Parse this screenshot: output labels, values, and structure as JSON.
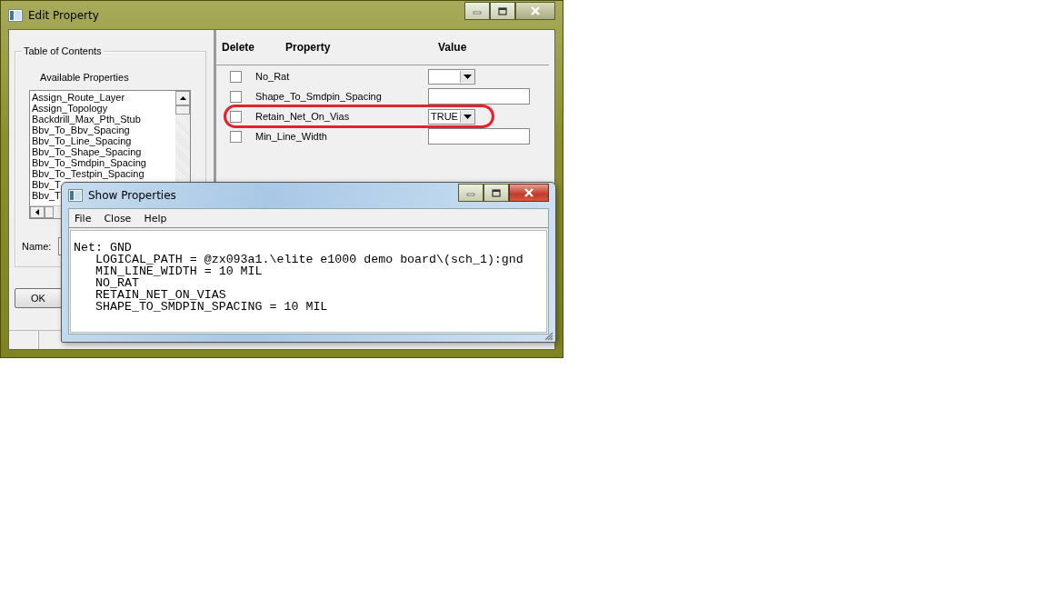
{
  "edit_window": {
    "title": "Edit Property",
    "table_of_contents": {
      "title": "Table of Contents",
      "list_label": "Available Properties",
      "items": [
        "Assign_Route_Layer",
        "Assign_Topology",
        "Backdrill_Max_Pth_Stub",
        "Bbv_To_Bbv_Spacing",
        "Bbv_To_Line_Spacing",
        "Bbv_To_Shape_Spacing",
        "Bbv_To_Smdpin_Spacing",
        "Bbv_To_Testpin_Spacing",
        "Bbv_T",
        "Bbv_T"
      ],
      "name_label": "Name:"
    },
    "ok_button": "OK",
    "columns": [
      "Delete",
      "Property",
      "Value"
    ],
    "rows": [
      {
        "checked": false,
        "name": "No_Rat",
        "kind": "dropdown",
        "highlighted": false
      },
      {
        "checked": false,
        "name": "Shape_To_Smdpin_Spacing",
        "kind": "text",
        "highlighted": false
      },
      {
        "checked": false,
        "name": "Retain_Net_On_Vias",
        "kind": "dropdown",
        "value": "TRUE",
        "highlighted": true
      },
      {
        "checked": false,
        "name": "Min_Line_Width",
        "kind": "text",
        "highlighted": false
      }
    ]
  },
  "show_window": {
    "title": "Show Properties",
    "menu": [
      "File",
      "Close",
      "Help"
    ],
    "net": "Net: GND",
    "properties": [
      "LOGICAL_PATH = @zx093a1.\\elite e1000 demo board\\(sch_1):gnd",
      "MIN_LINE_WIDTH = 10 MIL",
      "NO_RAT",
      "RETAIN_NET_ON_VIAS",
      "SHAPE_TO_SMDPIN_SPACING = 10 MIL"
    ]
  }
}
